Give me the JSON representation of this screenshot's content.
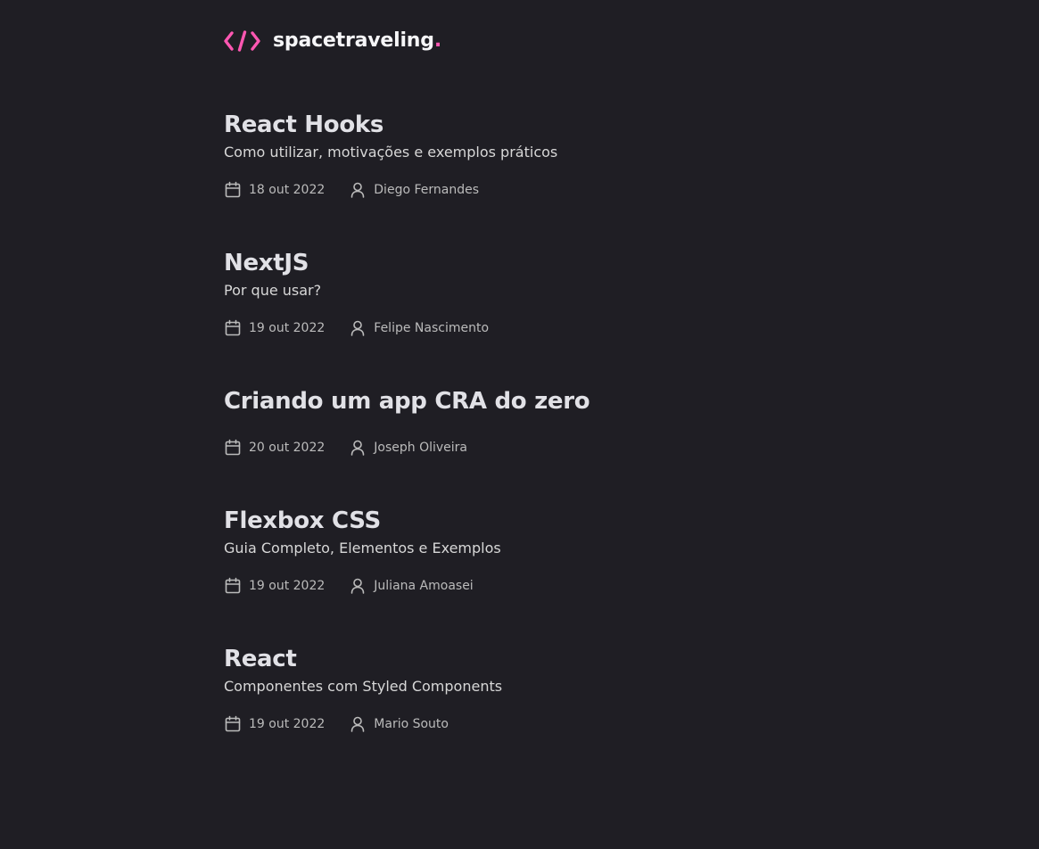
{
  "app": {
    "name": "spacetraveling",
    "name_dot": "."
  },
  "colors": {
    "background": "#1f1e24",
    "accent": "#ff57b2",
    "heading": "#e1e1e6",
    "body_text": "#d7d7d7",
    "meta_text": "#bbbbbb"
  },
  "icons": {
    "logo": "code-brackets-icon",
    "date": "calendar-icon",
    "author": "user-icon"
  },
  "posts": [
    {
      "title": "React Hooks",
      "subtitle": "Como utilizar, motivações e exemplos práticos",
      "date": "18 out 2022",
      "author": "Diego Fernandes"
    },
    {
      "title": "NextJS",
      "subtitle": "Por que usar?",
      "date": "19 out 2022",
      "author": "Felipe Nascimento"
    },
    {
      "title": "Criando um app CRA do zero",
      "subtitle": "",
      "date": "20 out 2022",
      "author": "Joseph Oliveira"
    },
    {
      "title": "Flexbox CSS",
      "subtitle": "Guia Completo, Elementos e Exemplos",
      "date": "19 out 2022",
      "author": "Juliana Amoasei"
    },
    {
      "title": "React",
      "subtitle": "Componentes com Styled Components",
      "date": "19 out 2022",
      "author": "Mario Souto"
    }
  ]
}
